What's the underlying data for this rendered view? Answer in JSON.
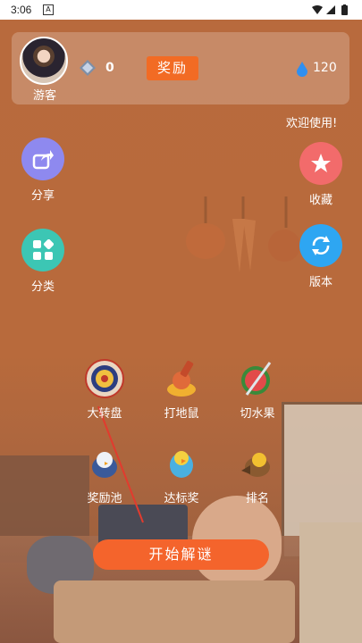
{
  "status_bar": {
    "time": "3:06",
    "notif_badge": "A"
  },
  "profile": {
    "nickname": "游客",
    "gem_count": "0",
    "reward_label": "奖励",
    "water_count": "120"
  },
  "marquee_text": "欢迎使用!",
  "side_left": [
    {
      "label": "分享",
      "icon": "share-icon",
      "color": "#8e89ef"
    },
    {
      "label": "分类",
      "icon": "grid-icon",
      "color": "#3cc6b4"
    }
  ],
  "side_right": [
    {
      "label": "收藏",
      "icon": "star-icon",
      "color": "#f26b6b"
    },
    {
      "label": "版本",
      "icon": "refresh-icon",
      "color": "#2ea6f2"
    }
  ],
  "games": [
    {
      "label": "大转盘",
      "icon": "wheel-icon"
    },
    {
      "label": "打地鼠",
      "icon": "mole-icon"
    },
    {
      "label": "切水果",
      "icon": "watermelon-icon"
    },
    {
      "label": "奖励池",
      "icon": "bird-icon"
    },
    {
      "label": "达标奖",
      "icon": "parrot-icon"
    },
    {
      "label": "排名",
      "icon": "sparrow-icon"
    }
  ],
  "start_label": "开始解谜"
}
